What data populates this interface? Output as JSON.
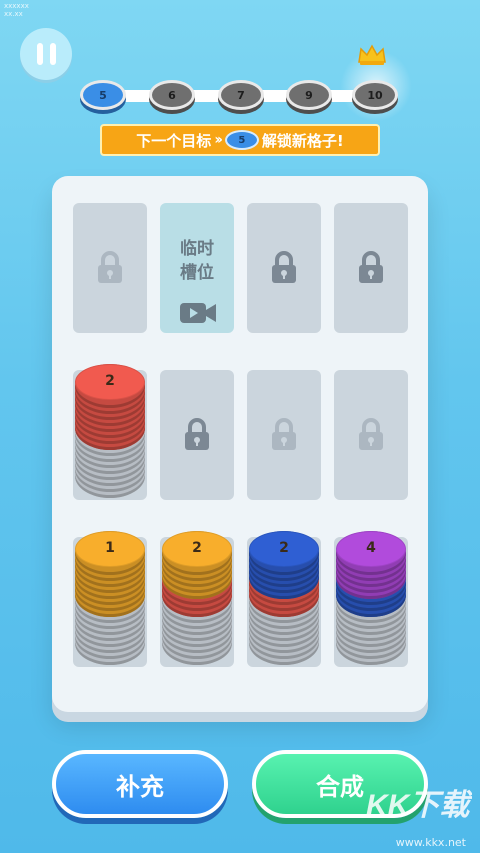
{
  "corner_logo": [
    "xxxxxx",
    "xx.xx"
  ],
  "progress": {
    "current_level": "5",
    "levels": [
      "5",
      "6",
      "7",
      "9",
      "10"
    ]
  },
  "banner": {
    "prefix": "下一个目标",
    "target": "5",
    "suffix": "解锁新格子!"
  },
  "board": {
    "temp_slot_label_1": "临时",
    "temp_slot_label_2": "槽位",
    "slots": [
      {
        "row": 1,
        "col": 1,
        "state": "locked-faded"
      },
      {
        "row": 1,
        "col": 2,
        "state": "temp-video"
      },
      {
        "row": 1,
        "col": 3,
        "state": "locked"
      },
      {
        "row": 1,
        "col": 4,
        "state": "locked"
      },
      {
        "row": 2,
        "col": 1,
        "state": "stack",
        "top_value": "2",
        "top_color": "red"
      },
      {
        "row": 2,
        "col": 2,
        "state": "locked"
      },
      {
        "row": 2,
        "col": 3,
        "state": "locked-faded"
      },
      {
        "row": 2,
        "col": 4,
        "state": "locked-faded"
      },
      {
        "row": 3,
        "col": 1,
        "state": "stack",
        "top_value": "1",
        "top_color": "orange"
      },
      {
        "row": 3,
        "col": 2,
        "state": "stack",
        "top_value": "2",
        "top_color": "red"
      },
      {
        "row": 3,
        "col": 3,
        "state": "stack",
        "top_value": "2",
        "top_color": "red"
      },
      {
        "row": 3,
        "col": 4,
        "state": "stack",
        "top_value": "4",
        "top_color": "blue"
      }
    ]
  },
  "buttons": {
    "refill": "补充",
    "merge": "合成"
  },
  "watermark": "www.kkx.net",
  "colors": {
    "red": "#f15a4f",
    "orange": "#f8ae2c",
    "blue": "#2f5fd3",
    "purple": "#b14bdc",
    "white_disc": "#dfe6ef"
  }
}
